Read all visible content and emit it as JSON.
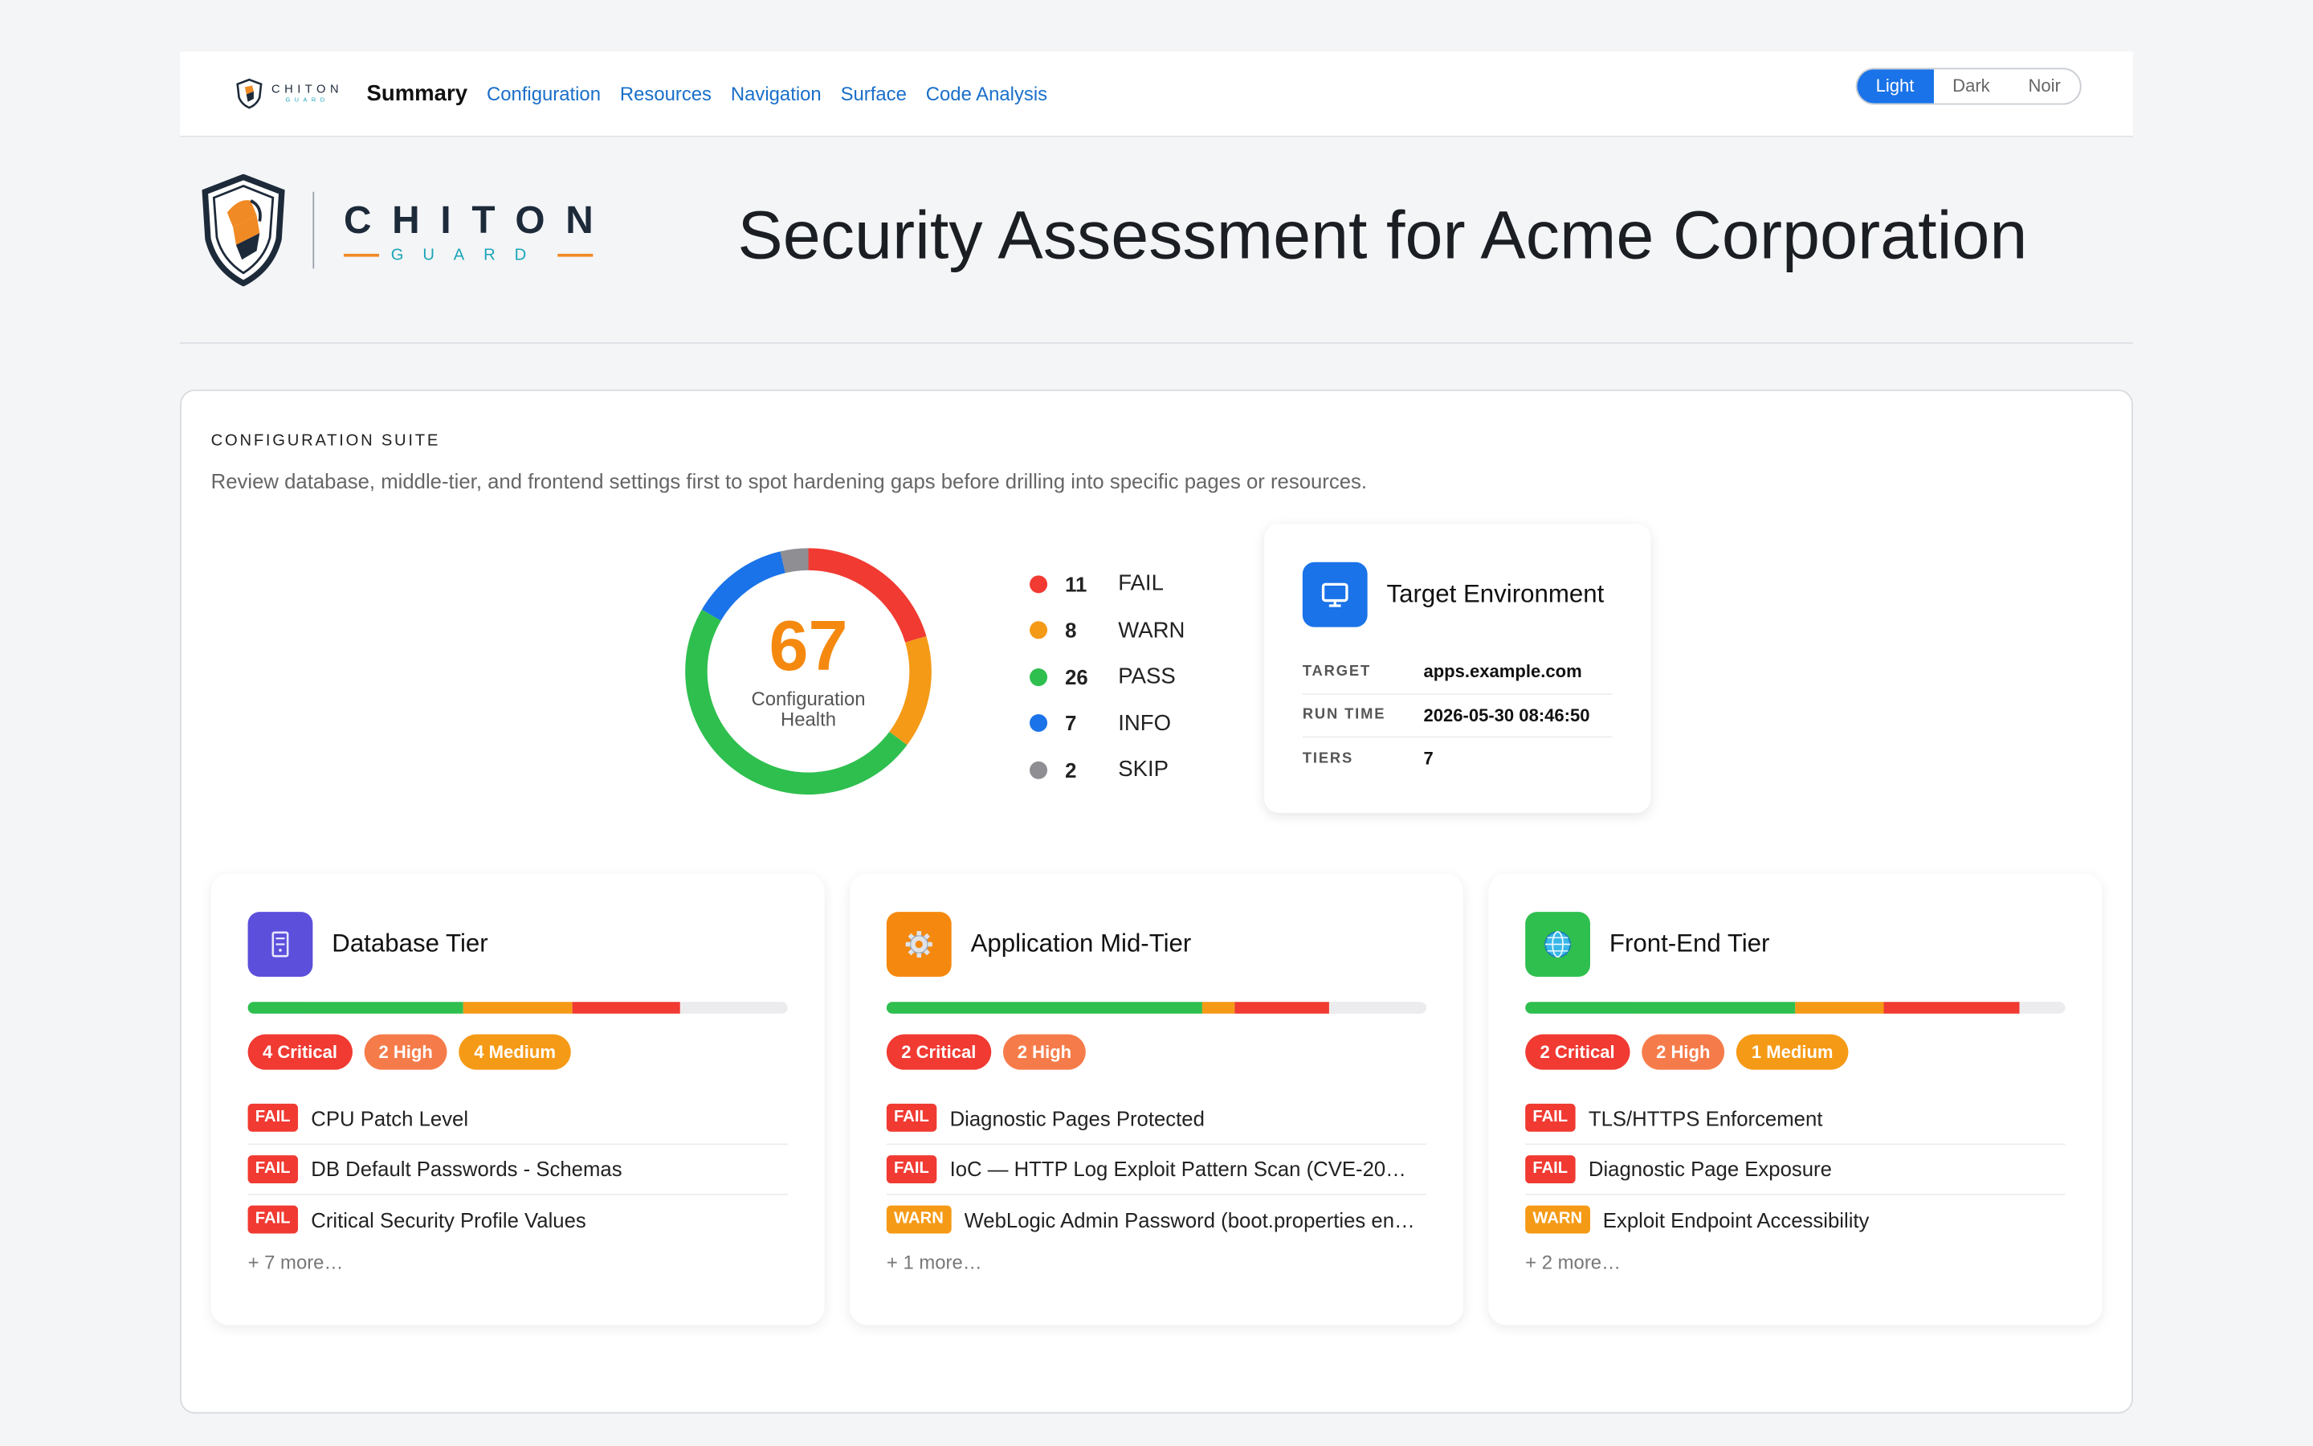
{
  "nav": {
    "logo_text": "CHITON",
    "logo_sub": "GUARD",
    "summary": "Summary",
    "links": [
      "Configuration",
      "Resources",
      "Navigation",
      "Surface",
      "Code Analysis"
    ],
    "themes": [
      "Light",
      "Dark",
      "Noir"
    ],
    "active_theme": "Light"
  },
  "hero": {
    "brand_main": "CHITON",
    "brand_sub": "GUARD",
    "title": "Security Assessment for Acme Corporation"
  },
  "suite": {
    "kicker": "CONFIGURATION SUITE",
    "description": "Review database, middle-tier, and frontend settings first to spot hardening gaps before drilling into specific pages or resources.",
    "score": "67",
    "score_label": "Configuration Health",
    "legend": [
      {
        "count": "11",
        "name": "FAIL",
        "color": "#f03a32"
      },
      {
        "count": "8",
        "name": "WARN",
        "color": "#f59a16"
      },
      {
        "count": "26",
        "name": "PASS",
        "color": "#2fbf4f"
      },
      {
        "count": "7",
        "name": "INFO",
        "color": "#1a73e8"
      },
      {
        "count": "2",
        "name": "SKIP",
        "color": "#8e8e93"
      }
    ]
  },
  "environment": {
    "title": "Target Environment",
    "rows": [
      {
        "key": "TARGET",
        "value": "apps.example.com"
      },
      {
        "key": "RUN TIME",
        "value": "2026-05-30 08:46:50"
      },
      {
        "key": "TIERS",
        "value": "7"
      }
    ]
  },
  "tiers": [
    {
      "title": "Database Tier",
      "icon": "server-icon",
      "icon_color": "#5b4fdb",
      "bar": {
        "pass": 0.4,
        "warn": 0.2,
        "fail": 0.2
      },
      "badges": [
        {
          "label": "4 Critical",
          "kind": "crit"
        },
        {
          "label": "2 High",
          "kind": "high"
        },
        {
          "label": "4 Medium",
          "kind": "med"
        }
      ],
      "findings": [
        {
          "tag": "FAIL",
          "text": "CPU Patch Level"
        },
        {
          "tag": "FAIL",
          "text": "DB Default Passwords - Schemas"
        },
        {
          "tag": "FAIL",
          "text": "Critical Security Profile Values"
        }
      ],
      "more": "+ 7 more…"
    },
    {
      "title": "Application Mid-Tier",
      "icon": "gear-icon",
      "icon_color": "#f5890f",
      "bar": {
        "pass": 0.585,
        "warn": 0.06,
        "fail": 0.175
      },
      "badges": [
        {
          "label": "2 Critical",
          "kind": "crit"
        },
        {
          "label": "2 High",
          "kind": "high"
        }
      ],
      "findings": [
        {
          "tag": "FAIL",
          "text": "Diagnostic Pages Protected"
        },
        {
          "tag": "FAIL",
          "text": "IoC — HTTP Log Exploit Pattern Scan (CVE-20…"
        },
        {
          "tag": "WARN",
          "text": "WebLogic Admin Password (boot.properties en…"
        }
      ],
      "more": "+ 1 more…"
    },
    {
      "title": "Front-End Tier",
      "icon": "globe-icon",
      "icon_color": "#2fbf4f",
      "bar": {
        "pass": 0.5,
        "warn": 0.165,
        "fail": 0.25
      },
      "badges": [
        {
          "label": "2 Critical",
          "kind": "crit"
        },
        {
          "label": "2 High",
          "kind": "high"
        },
        {
          "label": "1 Medium",
          "kind": "med"
        }
      ],
      "findings": [
        {
          "tag": "FAIL",
          "text": "TLS/HTTPS Enforcement"
        },
        {
          "tag": "FAIL",
          "text": "Diagnostic Page Exposure"
        },
        {
          "tag": "WARN",
          "text": "Exploit Endpoint Accessibility"
        }
      ],
      "more": "+ 2 more…"
    }
  ],
  "donut_segments": [
    {
      "name": "FAIL",
      "value": 11,
      "color": "#f03a32"
    },
    {
      "name": "WARN",
      "value": 8,
      "color": "#f59a16"
    },
    {
      "name": "PASS",
      "value": 26,
      "color": "#2fbf4f"
    },
    {
      "name": "INFO",
      "value": 7,
      "color": "#1a73e8"
    },
    {
      "name": "SKIP",
      "value": 2,
      "color": "#8e8e93"
    }
  ]
}
